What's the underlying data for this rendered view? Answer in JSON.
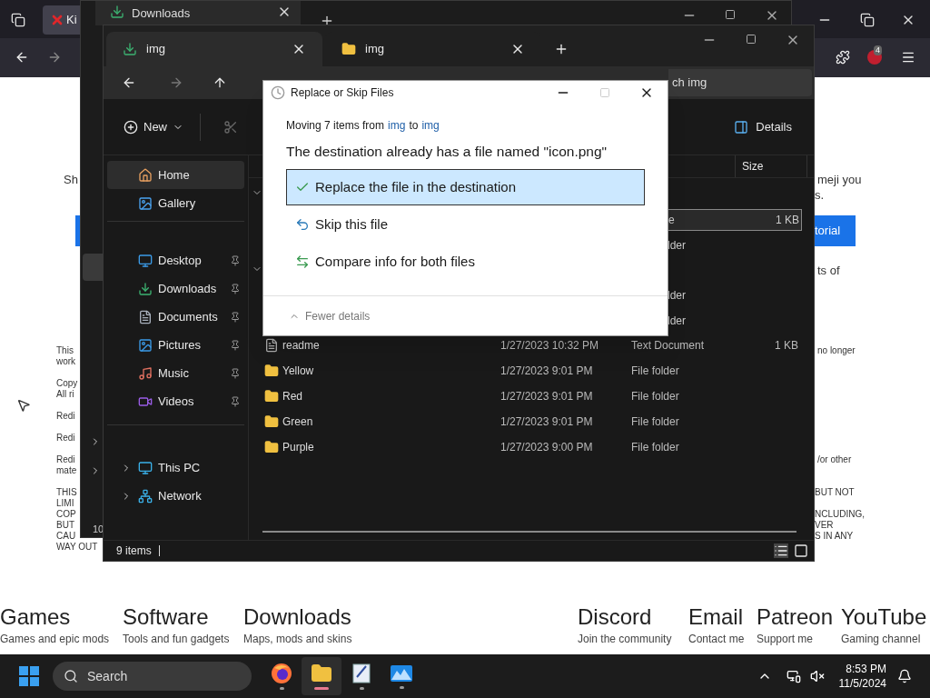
{
  "browser": {
    "tab": {
      "label": "Ki"
    },
    "extension_badge": "4"
  },
  "page": {
    "left_fragments": [
      "Sh",
      "This",
      "work",
      "Copy",
      "All ri",
      "Redi",
      "Redi",
      "Redi",
      "mate",
      "THIS",
      "LIMI",
      "COP",
      "BUT",
      "CAU",
      "WAY OUT"
    ],
    "right_fragments": [
      "meji you",
      "s.",
      "ts of",
      "no longer",
      "/or other",
      "BUT NOT",
      "NCLUDING,",
      "VER",
      "S IN ANY"
    ],
    "right_button": "torial",
    "nav": [
      {
        "title": "Games",
        "subtitle": "Games and epic mods"
      },
      {
        "title": "Software",
        "subtitle": "Tools and fun gadgets"
      },
      {
        "title": "Downloads",
        "subtitle": "Maps, mods and skins"
      },
      {
        "title": "Discord",
        "subtitle": "Join the community"
      },
      {
        "title": "Email",
        "subtitle": "Contact me"
      },
      {
        "title": "Patreon",
        "subtitle": "Support me"
      },
      {
        "title": "YouTube",
        "subtitle": "Gaming channel"
      }
    ]
  },
  "back_window": {
    "tab": "Downloads",
    "status_fragment": "10"
  },
  "explorer": {
    "tabs": [
      {
        "label": "img",
        "selected": true
      },
      {
        "label": "img",
        "selected": false
      }
    ],
    "search_value": "ch img",
    "new_label": "New",
    "details_label": "Details",
    "sidebar_groups": [
      [
        {
          "label": "Home",
          "selected": true,
          "pinned": false
        },
        {
          "label": "Gallery",
          "selected": false,
          "pinned": false
        }
      ],
      [
        {
          "label": "Desktop",
          "selected": false,
          "pinned": true
        },
        {
          "label": "Downloads",
          "selected": false,
          "pinned": true
        },
        {
          "label": "Documents",
          "selected": false,
          "pinned": true
        },
        {
          "label": "Pictures",
          "selected": false,
          "pinned": true
        },
        {
          "label": "Music",
          "selected": false,
          "pinned": true
        },
        {
          "label": "Videos",
          "selected": false,
          "pinned": true
        }
      ],
      [
        {
          "label": "This PC",
          "selected": false,
          "pinned": false
        },
        {
          "label": "Network",
          "selected": false,
          "pinned": false
        }
      ]
    ],
    "size_column": "Size",
    "partial_rows": [
      {
        "type": "e",
        "size": "1 KB",
        "selected": true
      },
      {
        "type": "lder",
        "selected": false
      },
      {
        "type": "lder",
        "selected": false
      },
      {
        "type": "lder",
        "selected": false
      }
    ],
    "rows": [
      {
        "kind": "text",
        "name": "readme",
        "date": "1/27/2023 10:32 PM",
        "type": "Text Document",
        "size": "1 KB"
      },
      {
        "kind": "folder",
        "name": "Yellow",
        "date": "1/27/2023 9:01 PM",
        "type": "File folder"
      },
      {
        "kind": "folder",
        "name": "Red",
        "date": "1/27/2023 9:01 PM",
        "type": "File folder"
      },
      {
        "kind": "folder",
        "name": "Green",
        "date": "1/27/2023 9:01 PM",
        "type": "File folder"
      },
      {
        "kind": "folder",
        "name": "Purple",
        "date": "1/27/2023 9:00 PM",
        "type": "File folder"
      }
    ],
    "status": "9 items"
  },
  "dialog": {
    "title": "Replace or Skip Files",
    "moving_prefix": "Moving 7 items from",
    "source": "img",
    "moving_middle": "to",
    "destination": "img",
    "heading": "The destination already has a file named \"icon.png\"",
    "options": [
      {
        "label": "Replace the file in the destination",
        "selected": true
      },
      {
        "label": "Skip this file",
        "selected": false
      },
      {
        "label": "Compare info for both files",
        "selected": false
      }
    ],
    "maximize_disabled": true,
    "footer": "Fewer details"
  },
  "taskbar": {
    "search": "Search",
    "apps": [
      {
        "kind": "firefox",
        "active": false
      },
      {
        "kind": "explorer",
        "active": true
      },
      {
        "kind": "notepad",
        "active": false
      },
      {
        "kind": "photos",
        "active": false
      }
    ],
    "time": "8:53 PM",
    "date": "11/5/2024"
  }
}
